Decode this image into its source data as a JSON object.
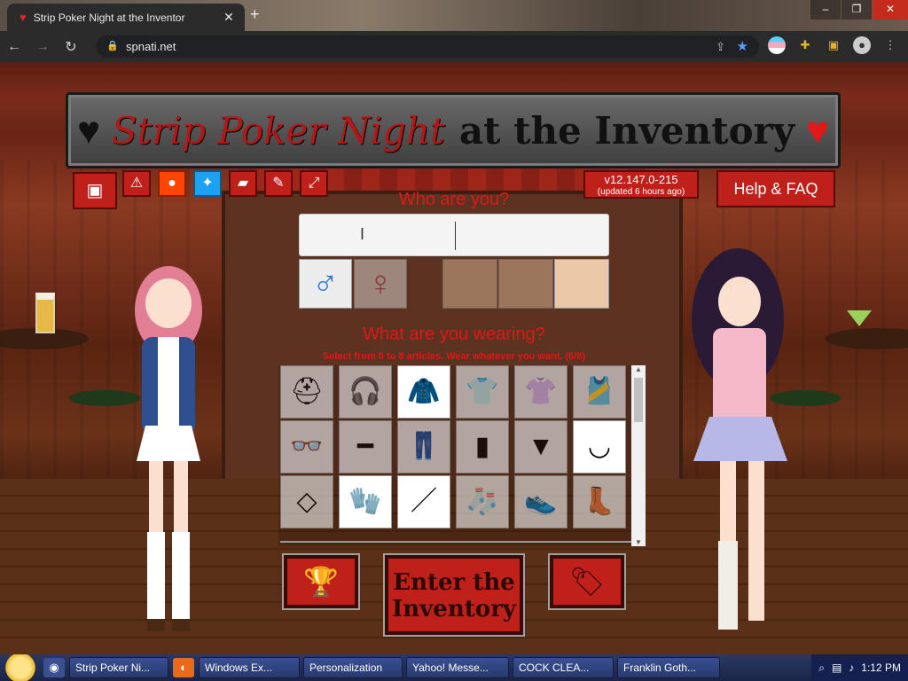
{
  "browser": {
    "tab_title": "Strip Poker Night at the Inventor",
    "tab_favicon": "heart-favicon",
    "url": "spnati.net",
    "window_controls": [
      "–",
      "❐",
      "✕"
    ]
  },
  "game": {
    "title_part1": "Strip Poker Night",
    "title_part2": "at the Inventory",
    "version": "v12.147.0-215",
    "version_note": "(updated 6 hours ago)",
    "help_label": "Help & FAQ",
    "top_icons": [
      "image-icon",
      "warning-icon",
      "reddit-icon",
      "twitter-icon",
      "folder-icon",
      "wrench-icon",
      "fullscreen-icon"
    ],
    "who_label": "Who are you?",
    "name_value": "",
    "wear_label": "What are you wearing?",
    "wear_sub": "Select from 0 to 8 articles. Wear whatever you want. (6/8)",
    "clothing": [
      {
        "name": "bandana",
        "selected": false
      },
      {
        "name": "headphones",
        "selected": false
      },
      {
        "name": "jacket",
        "selected": true
      },
      {
        "name": "shirt",
        "selected": false
      },
      {
        "name": "tshirt",
        "selected": false
      },
      {
        "name": "tank-top",
        "selected": false
      },
      {
        "name": "glasses",
        "selected": false
      },
      {
        "name": "belt",
        "selected": false
      },
      {
        "name": "jeans",
        "selected": false
      },
      {
        "name": "shorts",
        "selected": false
      },
      {
        "name": "skirt",
        "selected": false
      },
      {
        "name": "underwear",
        "selected": true
      },
      {
        "name": "necklace",
        "selected": false
      },
      {
        "name": "gloves",
        "selected": true
      },
      {
        "name": "tie",
        "selected": true
      },
      {
        "name": "socks",
        "selected": false
      },
      {
        "name": "shoes",
        "selected": false
      },
      {
        "name": "boots",
        "selected": false
      }
    ],
    "enter_line1": "Enter the",
    "enter_line2": "Inventory"
  },
  "taskbar": {
    "items": [
      "Strip Poker Ni...",
      "Windows Ex...",
      "Personalization",
      "Yahoo! Messe...",
      "COCK CLEA...",
      "Franklin Goth..."
    ],
    "clock": "1:12 PM"
  }
}
